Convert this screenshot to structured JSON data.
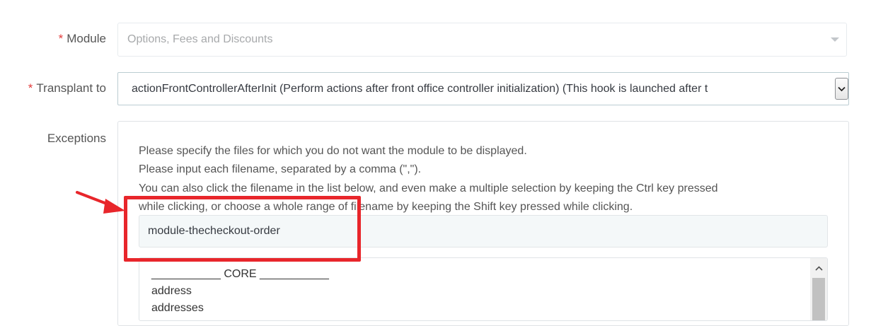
{
  "form": {
    "module": {
      "required_mark": "*",
      "label": "Module",
      "value": "Options, Fees and Discounts"
    },
    "transplant": {
      "required_mark": "*",
      "label": "Transplant to",
      "value": "actionFrontControllerAfterInit (Perform actions after front office controller initialization) (This hook is launched after t"
    },
    "exceptions": {
      "label": "Exceptions",
      "help": [
        "Please specify the files for which you do not want the module to be displayed.",
        "Please input each filename, separated by a comma (\",\").",
        "You can also click the filename in the list below, and even make a multiple selection by keeping the Ctrl key pressed",
        "while clicking, or choose a whole range of filename by keeping the Shift key pressed while clicking."
      ],
      "input_value": "module-thecheckout-order",
      "list_items": [
        "___________ CORE ___________",
        "address",
        "addresses"
      ]
    }
  },
  "colors": {
    "required": "#e23b3b",
    "highlight": "#e8262b"
  },
  "icons": {
    "module_caret": "caret-down-icon",
    "transplant_arrow": "chevron-down-icon",
    "list_scroll_up": "scroll-up-icon",
    "annotation": "red-arrow-icon"
  }
}
